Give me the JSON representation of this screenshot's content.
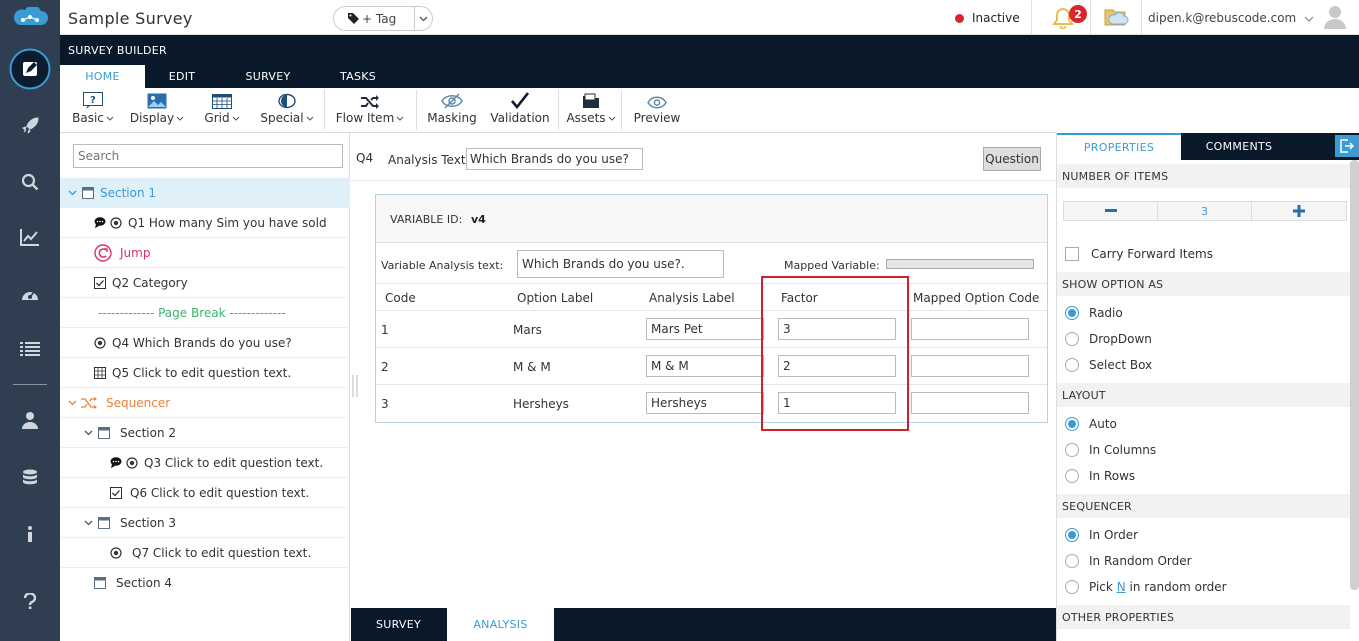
{
  "app": {
    "title": "Sample Survey"
  },
  "topbar": {
    "tag_label": "+ Tag",
    "status_text": "Inactive",
    "status_color": "#d9262c",
    "notification_count": "2",
    "user_email": "dipen.k@rebuscode.com"
  },
  "left_nav": {
    "icons": [
      "edit-icon",
      "rocket-icon",
      "search-icon",
      "trend-chart-icon",
      "dashboard-icon",
      "list-icon",
      "user-icon",
      "database-icon",
      "info-icon",
      "help-icon"
    ]
  },
  "builder": {
    "title": "SURVEY BUILDER",
    "tabs": [
      "HOME",
      "EDIT",
      "SURVEY",
      "TASKS"
    ],
    "active_tab": "HOME"
  },
  "ribbon": {
    "items": [
      {
        "label": "Basic",
        "icon": "question-icon"
      },
      {
        "label": "Display",
        "icon": "image-icon"
      },
      {
        "label": "Grid",
        "icon": "grid-icon"
      },
      {
        "label": "Special",
        "icon": "special-icon"
      },
      {
        "label": "Flow Item",
        "icon": "flow-icon"
      },
      {
        "label": "Masking",
        "icon": "eye-slash-icon"
      },
      {
        "label": "Validation",
        "icon": "checkmark-icon"
      },
      {
        "label": "Assets",
        "icon": "folder-icon"
      },
      {
        "label": "Preview",
        "icon": "eye-icon"
      }
    ]
  },
  "tree": {
    "search_placeholder": "Search",
    "rows": [
      {
        "text": "Section 1"
      },
      {
        "text": "Q1 How many Sim you have sold"
      },
      {
        "text": "Jump"
      },
      {
        "text": "Q2 Category"
      },
      {
        "text": "------------- Page Break -------------"
      },
      {
        "text": "Q4 Which Brands do you use?"
      },
      {
        "text": "Q5 Click to edit question text."
      },
      {
        "text": "Sequencer"
      },
      {
        "text": "Section 2"
      },
      {
        "text": "Q3 Click to edit question text."
      },
      {
        "text": "Q6 Click to edit question text."
      },
      {
        "text": "Section 3"
      },
      {
        "text": "Q7 Click to edit question text."
      },
      {
        "text": "Section 4"
      }
    ]
  },
  "editor": {
    "question_number": "Q4",
    "analysis_text_label": "Analysis Text:",
    "analysis_text_value": "Which Brands do you use?",
    "question_button": "Question",
    "variable_id_label": "VARIABLE ID:",
    "variable_id_value": "v4",
    "variable_analysis_label": "Variable Analysis text:",
    "variable_analysis_value": "Which Brands do you use?.",
    "mapped_variable_label": "Mapped Variable:",
    "columns": [
      "Code",
      "Option Label",
      "Analysis Label",
      "Factor",
      "Mapped Option Code"
    ],
    "rows": [
      {
        "code": "1",
        "option_label": "Mars",
        "analysis_label": "Mars Pet",
        "factor": "3",
        "mapped": ""
      },
      {
        "code": "2",
        "option_label": "M & M",
        "analysis_label": "M & M",
        "factor": "2",
        "mapped": ""
      },
      {
        "code": "3",
        "option_label": "Hersheys",
        "analysis_label": "Hersheys",
        "factor": "1",
        "mapped": ""
      }
    ]
  },
  "bottom_tabs": {
    "survey": "SURVEY",
    "analysis": "ANALYSIS"
  },
  "properties": {
    "tabs": {
      "properties": "PROPERTIES",
      "comments": "COMMENTS"
    },
    "number_of_items_header": "NUMBER OF ITEMS",
    "number_of_items_value": "3",
    "carry_forward_label": "Carry Forward Items",
    "show_option_as_header": "SHOW OPTION AS",
    "show_option_as": [
      "Radio",
      "DropDown",
      "Select Box"
    ],
    "layout_header": "LAYOUT",
    "layout": [
      "Auto",
      "In Columns",
      "In Rows"
    ],
    "sequencer_header": "SEQUENCER",
    "sequencer_in_order": "In Order",
    "sequencer_random": "In Random Order",
    "sequencer_pick_prefix": "Pick",
    "sequencer_pick_n": "N",
    "sequencer_pick_suffix": "in random order",
    "other_properties_header": "OTHER PROPERTIES"
  },
  "colors": {
    "accent": "#3a9bd5",
    "nav_bg": "#2f3f51",
    "header_bg": "#09192a",
    "highlight": "#d0202a",
    "jump": "#d6336c",
    "sequencer": "#e8833a",
    "page_break": "#3cb371"
  }
}
